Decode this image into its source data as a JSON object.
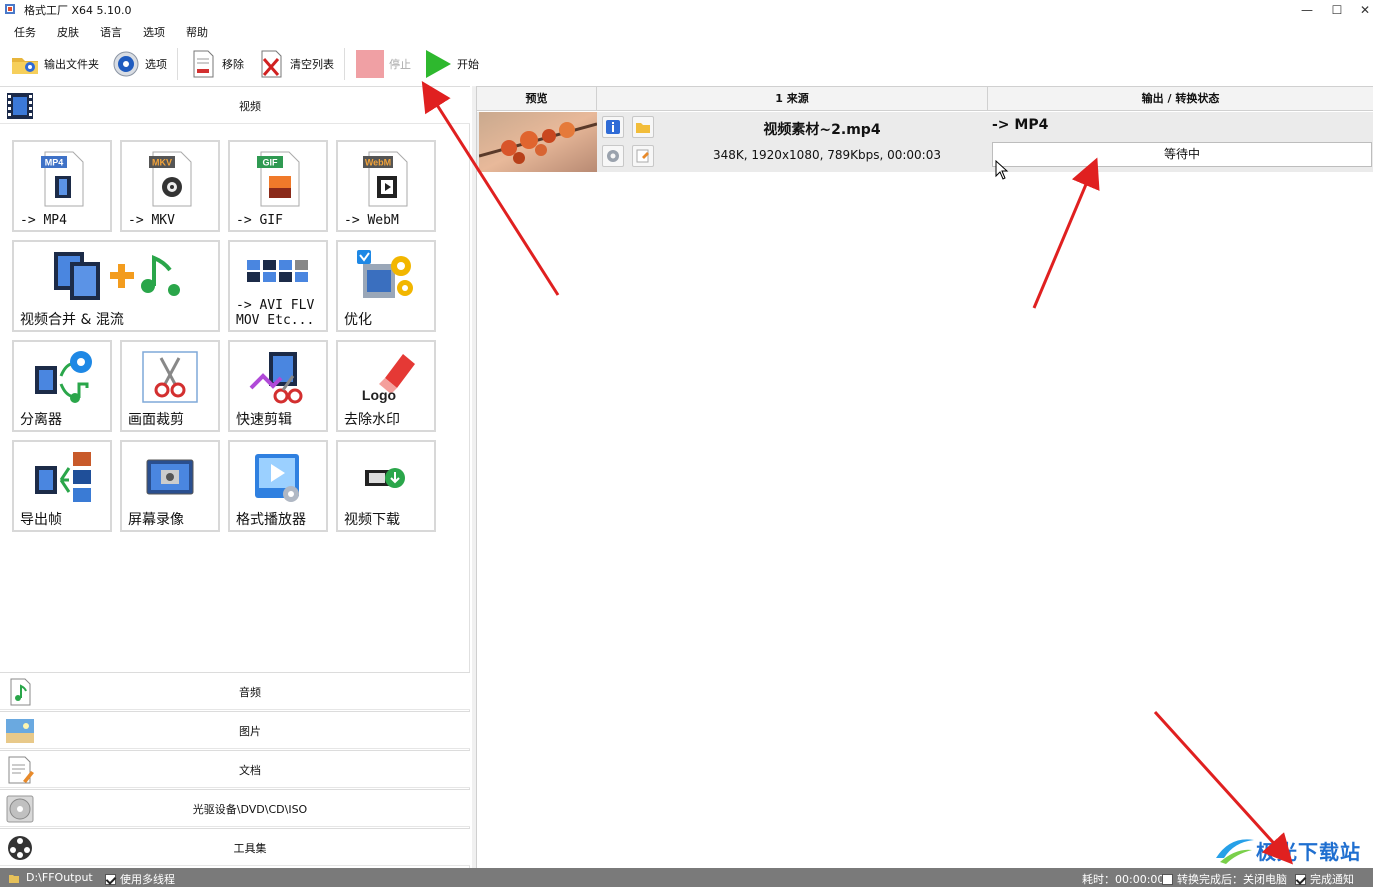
{
  "window": {
    "title": "格式工厂 X64 5.10.0",
    "minimize_glyph": "—",
    "maximize_glyph": "☐",
    "close_glyph": "✕"
  },
  "menu": [
    "任务",
    "皮肤",
    "语言",
    "选项",
    "帮助"
  ],
  "toolbar": {
    "output_folder": "输出文件夹",
    "options": "选项",
    "remove": "移除",
    "clear_list": "清空列表",
    "stop": "停止",
    "start": "开始"
  },
  "categories": {
    "video": "视频",
    "audio": "音频",
    "image": "图片",
    "document": "文档",
    "disc": "光驱设备\\DVD\\CD\\ISO",
    "tools": "工具集"
  },
  "video_tools": {
    "mp4": {
      "badge": "MP4",
      "label": "-> MP4"
    },
    "mkv": {
      "badge": "MKV",
      "label": "-> MKV"
    },
    "gif": {
      "badge": "GIF",
      "label": "-> GIF"
    },
    "webm": {
      "badge": "WebM",
      "label": "-> WebM"
    },
    "merge": {
      "label": "视频合并 & 混流"
    },
    "other_formats": {
      "label": "-> AVI FLV\nMOV Etc..."
    },
    "optimize": {
      "label": "优化"
    },
    "splitter": {
      "label": "分离器"
    },
    "crop": {
      "label": "画面裁剪"
    },
    "quick_clip": {
      "label": "快速剪辑"
    },
    "remove_watermark": {
      "label": "去除水印",
      "logo_text": "Logo"
    },
    "export_frames": {
      "label": "导出帧"
    },
    "screen_record": {
      "label": "屏幕录像"
    },
    "player": {
      "label": "格式播放器"
    },
    "download": {
      "label": "视频下载"
    }
  },
  "task_table": {
    "headers": {
      "preview": "预览",
      "source": "1 来源",
      "output": "输出 / 转换状态"
    },
    "rows": [
      {
        "filename": "视频素材~2.mp4",
        "info": "348K, 1920x1080, 789Kbps, 00:00:03",
        "output_format": "-> MP4",
        "status": "等待中"
      }
    ]
  },
  "statusbar": {
    "output_path": "D:\\FFOutput",
    "multithread_label": "使用多线程",
    "multithread_checked": true,
    "elapsed": "耗时：00:00:00",
    "after_convert_label": "转换完成后：关闭电脑",
    "after_convert_checked": false,
    "notify_label": "完成通知",
    "notify_checked": true
  },
  "watermark": {
    "text": "极光下载站"
  },
  "colors": {
    "start_green": "#2eb82e",
    "annotation_red": "#e02020",
    "watermark_blue": "#1f6fd0",
    "statusbar_gray": "#7a7a7a"
  }
}
